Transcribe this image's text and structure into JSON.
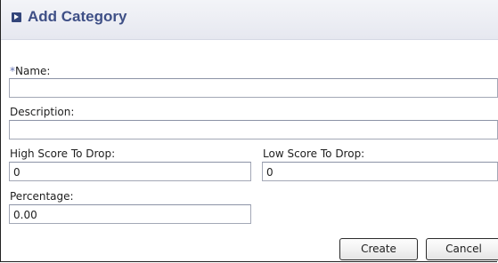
{
  "header": {
    "title": "Add Category",
    "icon": "expand-arrow-icon"
  },
  "form": {
    "name_required_marker": "*",
    "name_label": "Name:",
    "name_value": "",
    "description_label": "Description:",
    "description_value": "",
    "high_score_label": "High Score To Drop:",
    "high_score_value": "0",
    "low_score_label": "Low Score To Drop:",
    "low_score_value": "0",
    "percentage_label": "Percentage:",
    "percentage_value": "0.00"
  },
  "buttons": {
    "create_label": "Create",
    "cancel_label": "Cancel"
  },
  "colors": {
    "header_title": "#3e4f86",
    "required_marker": "#5f6fb1"
  }
}
